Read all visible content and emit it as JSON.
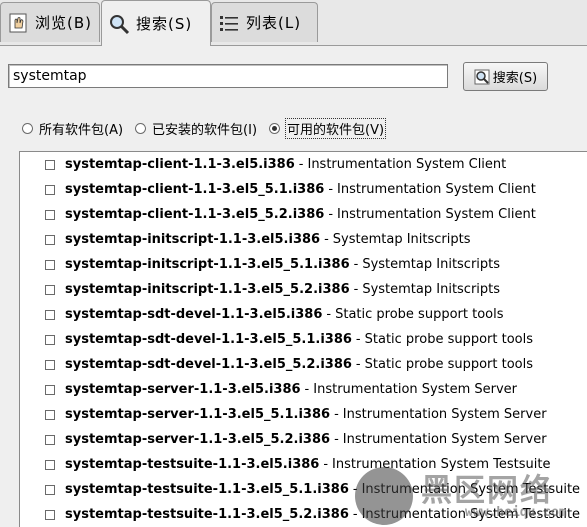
{
  "tabs": [
    {
      "label": "浏览(B)",
      "icon": "hand-icon"
    },
    {
      "label": "搜索(S)",
      "icon": "magnifier-icon"
    },
    {
      "label": "列表(L)",
      "icon": "list-icon"
    }
  ],
  "search": {
    "value": "systemtap",
    "button_label": "搜索(S)"
  },
  "filters": {
    "all": "所有软件包(A)",
    "installed": "已安装的软件包(I)",
    "available": "可用的软件包(V)",
    "selected": "available"
  },
  "packages": [
    {
      "name": "systemtap-client-1.1-3.el5.i386",
      "desc": "Instrumentation System Client"
    },
    {
      "name": "systemtap-client-1.1-3.el5_5.1.i386",
      "desc": "Instrumentation System Client"
    },
    {
      "name": "systemtap-client-1.1-3.el5_5.2.i386",
      "desc": "Instrumentation System Client"
    },
    {
      "name": "systemtap-initscript-1.1-3.el5.i386",
      "desc": "Systemtap Initscripts"
    },
    {
      "name": "systemtap-initscript-1.1-3.el5_5.1.i386",
      "desc": "Systemtap Initscripts"
    },
    {
      "name": "systemtap-initscript-1.1-3.el5_5.2.i386",
      "desc": "Systemtap Initscripts"
    },
    {
      "name": "systemtap-sdt-devel-1.1-3.el5.i386",
      "desc": "Static probe support tools"
    },
    {
      "name": "systemtap-sdt-devel-1.1-3.el5_5.1.i386",
      "desc": "Static probe support tools"
    },
    {
      "name": "systemtap-sdt-devel-1.1-3.el5_5.2.i386",
      "desc": "Static probe support tools"
    },
    {
      "name": "systemtap-server-1.1-3.el5.i386",
      "desc": "Instrumentation System Server"
    },
    {
      "name": "systemtap-server-1.1-3.el5_5.1.i386",
      "desc": "Instrumentation System Server"
    },
    {
      "name": "systemtap-server-1.1-3.el5_5.2.i386",
      "desc": "Instrumentation System Server"
    },
    {
      "name": "systemtap-testsuite-1.1-3.el5.i386",
      "desc": "Instrumentation System Testsuite"
    },
    {
      "name": "systemtap-testsuite-1.1-3.el5_5.1.i386",
      "desc": "Instrumentation System Testsuite"
    },
    {
      "name": "systemtap-testsuite-1.1-3.el5_5.2.i386",
      "desc": "Instrumentation System Testsuite"
    }
  ],
  "watermark": {
    "text": "黑区网络",
    "url": "www.heiqu.com"
  }
}
